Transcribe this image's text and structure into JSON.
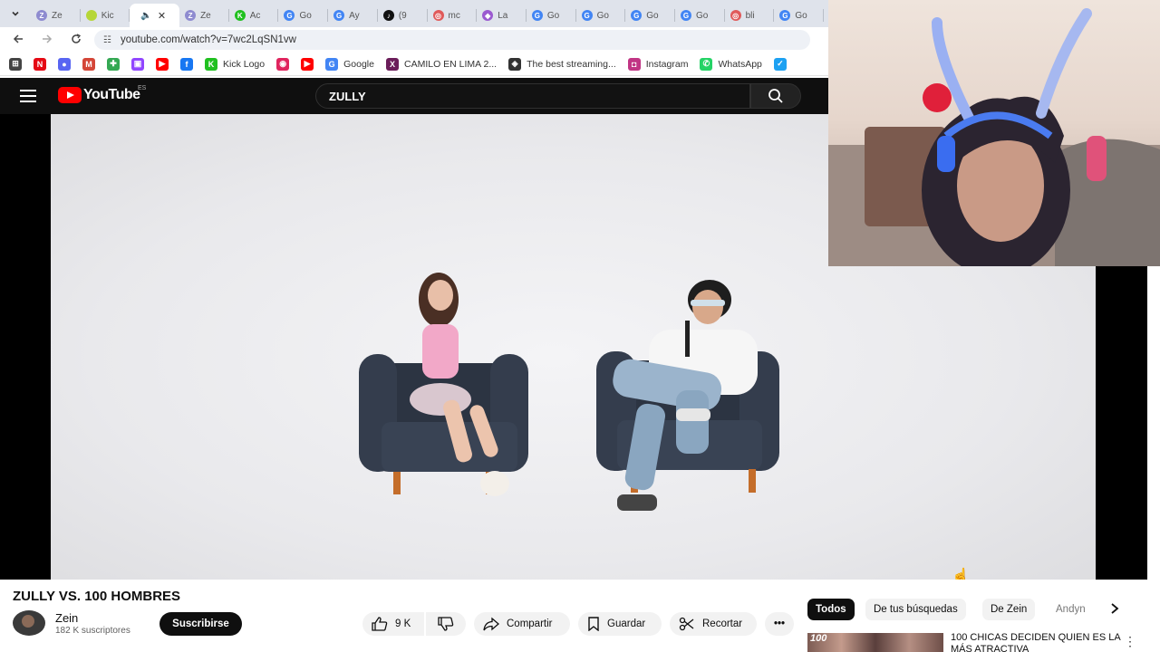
{
  "browser": {
    "tabs": [
      {
        "label": "Ze",
        "color": "#8e8bd0",
        "glyph": "Z"
      },
      {
        "label": "Kic",
        "color": "#b6d637",
        "glyph": ""
      },
      {
        "label": "",
        "color": "",
        "glyph": "",
        "active": true
      },
      {
        "label": "Ze",
        "color": "#8e8bd0",
        "glyph": "Z"
      },
      {
        "label": "Ac",
        "color": "#20c020",
        "glyph": "K"
      },
      {
        "label": "Go",
        "color": "#4285f4",
        "glyph": "G"
      },
      {
        "label": "Ay",
        "color": "#4285f4",
        "glyph": "G"
      },
      {
        "label": "(9",
        "color": "#111111",
        "glyph": "♪"
      },
      {
        "label": "mc",
        "color": "#e05a5a",
        "glyph": "◎"
      },
      {
        "label": "La",
        "color": "#9b59d0",
        "glyph": "◆"
      },
      {
        "label": "Go",
        "color": "#4285f4",
        "glyph": "G"
      },
      {
        "label": "Go",
        "color": "#4285f4",
        "glyph": "G"
      },
      {
        "label": "Go",
        "color": "#4285f4",
        "glyph": "G"
      },
      {
        "label": "Go",
        "color": "#4285f4",
        "glyph": "G"
      },
      {
        "label": "bli",
        "color": "#e05a5a",
        "glyph": "◎"
      },
      {
        "label": "Go",
        "color": "#4285f4",
        "glyph": "G"
      }
    ],
    "url": "youtube.com/watch?v=7wc2LqSN1vw",
    "bookmarks": [
      {
        "label": "",
        "icon": "apps-grid-icon",
        "color": "#444444",
        "glyph": "⊞"
      },
      {
        "label": "",
        "icon": "netflix-icon",
        "color": "#e50914",
        "glyph": "N"
      },
      {
        "label": "",
        "icon": "discord-icon",
        "color": "#5865f2",
        "glyph": "●"
      },
      {
        "label": "",
        "icon": "gmail-icon",
        "color": "#d44638",
        "glyph": "M"
      },
      {
        "label": "",
        "icon": "bookmark-green-icon",
        "color": "#34a853",
        "glyph": "✚"
      },
      {
        "label": "",
        "icon": "twitch-icon",
        "color": "#9146ff",
        "glyph": "▣"
      },
      {
        "label": "",
        "icon": "youtube-icon",
        "color": "#ff0000",
        "glyph": "▶"
      },
      {
        "label": "",
        "icon": "facebook-icon",
        "color": "#1877f2",
        "glyph": "f"
      },
      {
        "label": "Kick Logo",
        "icon": "kick-icon",
        "color": "#20c020",
        "glyph": "K"
      },
      {
        "label": "",
        "icon": "streaming-icon",
        "color": "#e0245e",
        "glyph": "◉"
      },
      {
        "label": "",
        "icon": "youtube-icon",
        "color": "#ff0000",
        "glyph": "▶"
      },
      {
        "label": "Google",
        "icon": "google-icon",
        "color": "#4285f4",
        "glyph": "G"
      },
      {
        "label": "CAMILO EN LIMA 2...",
        "icon": "bookmark-icon",
        "color": "#6b1d5a",
        "glyph": "X"
      },
      {
        "label": "The best streaming...",
        "icon": "streaming-site-icon",
        "color": "#333333",
        "glyph": "◈"
      },
      {
        "label": "Instagram",
        "icon": "instagram-icon",
        "color": "#c13584",
        "glyph": "◘"
      },
      {
        "label": "WhatsApp",
        "icon": "whatsapp-icon",
        "color": "#25d366",
        "glyph": "✆"
      },
      {
        "label": "",
        "icon": "twitter-icon",
        "color": "#1da1f2",
        "glyph": "✓"
      }
    ]
  },
  "youtube": {
    "logo_text": "YouTube",
    "country": "ES",
    "search_value": "ZULLY"
  },
  "video": {
    "title": "ZULLY VS. 100 HOMBRES",
    "channel": "Zein",
    "subscribers": "182 K suscriptores",
    "subscribe_label": "Suscribirse",
    "likes": "9 K",
    "share_label": "Compartir",
    "save_label": "Guardar",
    "clip_label": "Recortar"
  },
  "sidebar": {
    "chips": [
      "Todos",
      "De tus búsquedas",
      "De Zein",
      "Andyn"
    ],
    "recommended_title": "100 CHICAS DECIDEN QUIEN ES LA MÁS ATRACTIVA",
    "recommended_thumb_text": "100"
  }
}
